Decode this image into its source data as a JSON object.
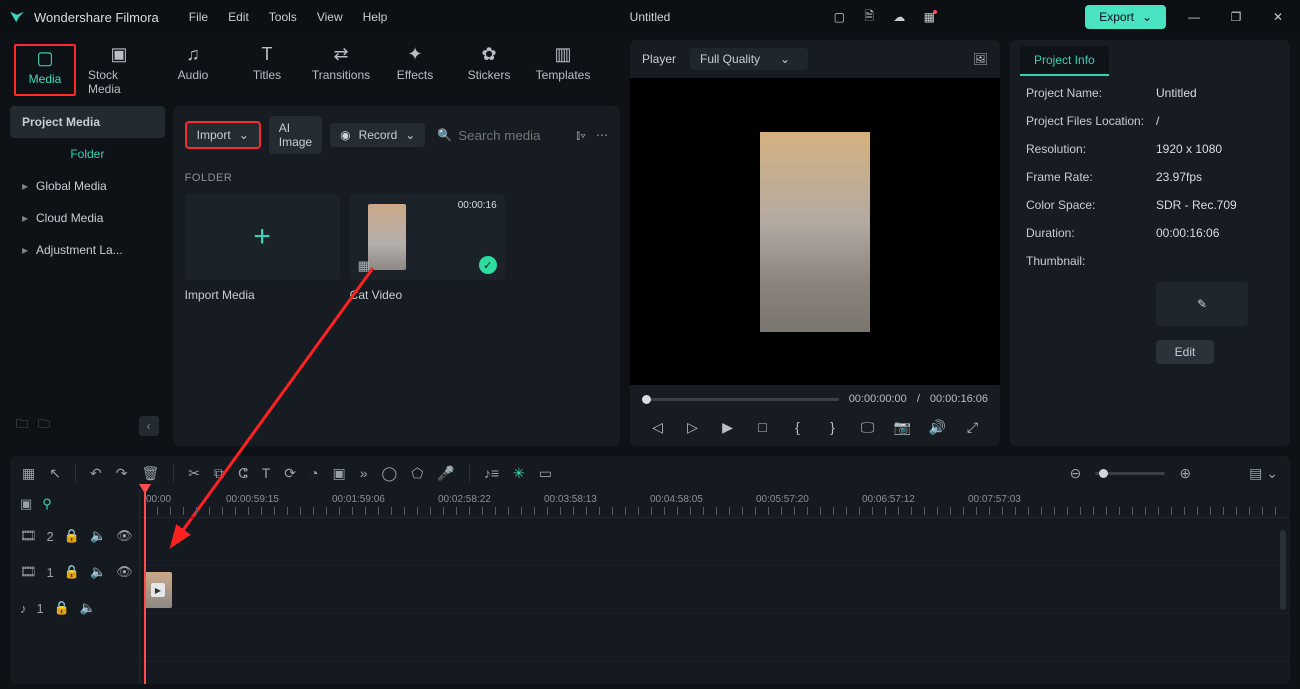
{
  "app": {
    "name": "Wondershare Filmora",
    "project_title": "Untitled"
  },
  "menubar": [
    "File",
    "Edit",
    "Tools",
    "View",
    "Help"
  ],
  "title_buttons": {
    "export": "Export"
  },
  "tabs": [
    {
      "id": "media",
      "label": "Media"
    },
    {
      "id": "stock",
      "label": "Stock Media"
    },
    {
      "id": "audio",
      "label": "Audio"
    },
    {
      "id": "titles",
      "label": "Titles"
    },
    {
      "id": "transitions",
      "label": "Transitions"
    },
    {
      "id": "effects",
      "label": "Effects"
    },
    {
      "id": "stickers",
      "label": "Stickers"
    },
    {
      "id": "templates",
      "label": "Templates"
    }
  ],
  "sidebar": {
    "project_media": "Project Media",
    "folder": "Folder",
    "items": [
      "Global Media",
      "Cloud Media",
      "Adjustment La..."
    ]
  },
  "import_bar": {
    "import": "Import",
    "ai_image": "AI Image",
    "record": "Record",
    "search_placeholder": "Search media"
  },
  "folder_label": "FOLDER",
  "tiles": {
    "import_media": "Import Media",
    "cat_video": "Cat Video",
    "cat_duration": "00:00:16"
  },
  "preview": {
    "player": "Player",
    "quality": "Full Quality",
    "current": "00:00:00:00",
    "sep": "/",
    "total": "00:00:16:06"
  },
  "info": {
    "tab": "Project Info",
    "rows": {
      "name_k": "Project Name:",
      "name_v": "Untitled",
      "loc_k": "Project Files Location:",
      "loc_v": "/",
      "res_k": "Resolution:",
      "res_v": "1920 x 1080",
      "fps_k": "Frame Rate:",
      "fps_v": "23.97fps",
      "cs_k": "Color Space:",
      "cs_v": "SDR - Rec.709",
      "dur_k": "Duration:",
      "dur_v": "00:00:16:06",
      "thumb_k": "Thumbnail:"
    },
    "edit": "Edit"
  },
  "ruler": [
    "00:00",
    "00:00:59:15",
    "00:01:59:06",
    "00:02:58:22",
    "00:03:58:13",
    "00:04:58:05",
    "00:05:57:20",
    "00:06:57:12",
    "00:07:57:03"
  ],
  "track_labels": {
    "v2": "2",
    "v1": "1",
    "a1": "1"
  }
}
